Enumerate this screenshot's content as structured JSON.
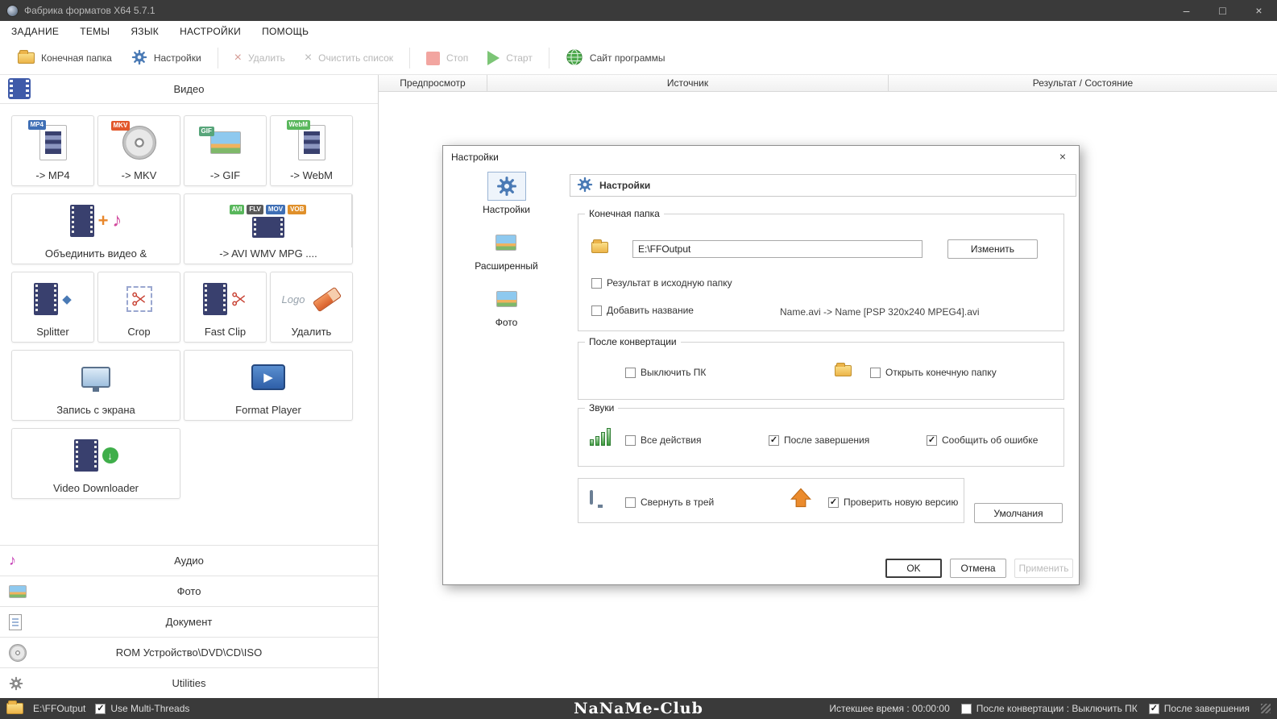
{
  "window": {
    "title": "Фабрика форматов X64 5.7.1",
    "controls": {
      "minimize": "–",
      "maximize": "□",
      "close": "×"
    }
  },
  "menu": {
    "items": [
      "ЗАДАНИЕ",
      "ТЕМЫ",
      "ЯЗЫК",
      "НАСТРОЙКИ",
      "ПОМОЩЬ"
    ]
  },
  "toolbar": {
    "output_folder": "Конечная папка",
    "settings": "Настройки",
    "delete": "Удалить",
    "clear_list": "Очистить список",
    "stop": "Стоп",
    "start": "Старт",
    "website": "Сайт программы"
  },
  "sidebar": {
    "video_header": "Видео",
    "tiles": [
      {
        "label": "-> MP4",
        "badge": "MP4"
      },
      {
        "label": "-> MKV",
        "badge": "MKV"
      },
      {
        "label": "-> GIF",
        "badge": "GIF"
      },
      {
        "label": "-> WebM",
        "badge": "WebM"
      },
      {
        "label": "Объединить видео &"
      },
      {
        "label": "-> AVI WMV MPG ....",
        "badges": [
          "AVI",
          "FLV",
          "MOV",
          "VOB"
        ]
      },
      {
        "label": "Splitter"
      },
      {
        "label": "Crop"
      },
      {
        "label": "Fast Clip"
      },
      {
        "label": "Удалить",
        "icon_text": "Logo"
      },
      {
        "label": "Запись с экрана"
      },
      {
        "label": "Format Player"
      },
      {
        "label": "Video Downloader"
      }
    ],
    "categories": [
      "Аудио",
      "Фото",
      "Документ",
      "ROM Устройство\\DVD\\CD\\ISO",
      "Utilities"
    ]
  },
  "main": {
    "columns": [
      "Предпросмотр",
      "Источник",
      "Результат / Состояние"
    ]
  },
  "dialog": {
    "title": "Настройки",
    "close": "×",
    "nav": [
      "Настройки",
      "Расширенный",
      "Фото"
    ],
    "header": "Настройки",
    "output_group": {
      "label": "Конечная папка",
      "path": "E:\\FFOutput",
      "change_button": "Изменить",
      "cb_source_folder": "Результат в исходную папку",
      "cb_add_name": "Добавить название",
      "example": "Name.avi  -> Name [PSP 320x240 MPEG4].avi"
    },
    "after_group": {
      "label": "После конвертации",
      "cb_shutdown": "Выключить ПК",
      "cb_open_folder": "Открыть конечную папку"
    },
    "sounds_group": {
      "label": "Звуки",
      "cb_all": "Все действия",
      "cb_done": "После завершения",
      "cb_error": "Сообщить об ошибке"
    },
    "misc": {
      "cb_tray": "Свернуть в трей",
      "cb_update": "Проверить новую версию",
      "defaults_button": "Умолчания"
    },
    "buttons": {
      "ok": "OK",
      "cancel": "Отмена",
      "apply": "Применить"
    },
    "checks": {
      "source_folder": false,
      "add_name": false,
      "shutdown": false,
      "open_folder": false,
      "all_sounds": false,
      "done_sound": true,
      "error_sound": true,
      "tray": false,
      "update": true
    }
  },
  "statusbar": {
    "path": "E:\\FFOutput",
    "multithreads": "Use Multi-Threads",
    "watermark": "NaNaMe-Club",
    "elapsed": "Истекшее время : 00:00:00",
    "after_convert": "После конвертации : Выключить ПК",
    "after_done": "После завершения",
    "checks": {
      "multithreads": true,
      "shutdown": false,
      "done": true
    }
  },
  "icons": {
    "app-icon": "round-logo",
    "folder-icon": "folder-shape",
    "gear-icon": "gear-svg",
    "delete-icon": "×",
    "clear-list-icon": "×",
    "stop-icon": "red-square",
    "start-icon": "▶",
    "globe-icon": "globe-svg",
    "power-icon": "power-ring",
    "sound-bars-icon": "green-bars",
    "tray-monitor-icon": "monitor-shape",
    "update-arrow-icon": "orange-up-arrow",
    "music-note-icon": "♪",
    "document-icon": "lined-doc",
    "disc-icon": "cd-disc",
    "scissors-icon": "scissors-svg",
    "check-glyph": "✓"
  }
}
